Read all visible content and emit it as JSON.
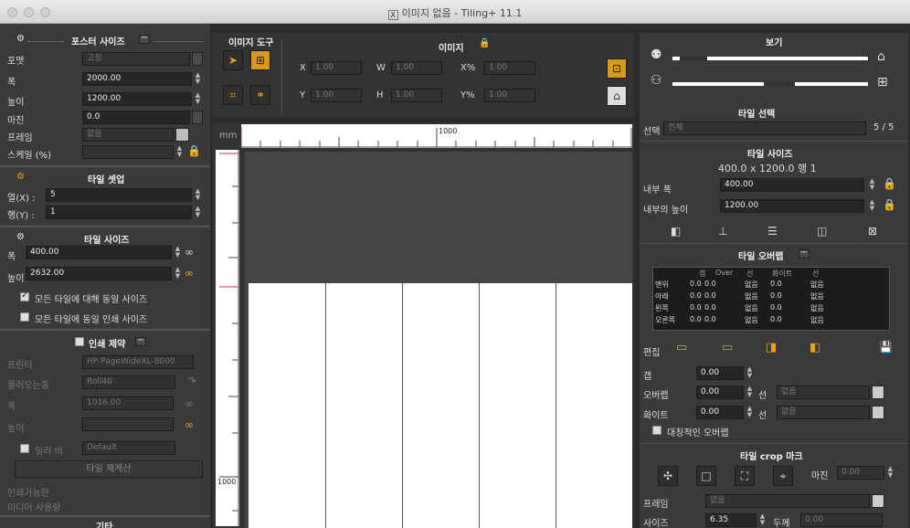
{
  "window": {
    "title": "이미지 없음 - Tiling+ 11.1"
  },
  "left": {
    "poster_size": {
      "header": "포스터 사이즈",
      "format_label": "포맷",
      "format_value": "고정",
      "width_label": "폭",
      "width_value": "2000.00",
      "height_label": "높이",
      "height_value": "1200.00",
      "margin_label": "마진",
      "margin_value": "0.0",
      "frame_label": "프레임",
      "frame_value": "없음",
      "scale_label": "스케일 (%)"
    },
    "tile_settings": {
      "header": "타일 셋업",
      "cols_label": "열(X) :",
      "cols_value": "5",
      "rows_label": "행(Y) :",
      "rows_value": "1"
    },
    "tile_size": {
      "header": "타일 사이즈",
      "width_label": "폭",
      "width_value": "400.00",
      "height_label": "높이",
      "height_value": "2632.00",
      "same_size_all": "모든 타일에 대해 동일 사이즈",
      "same_print_size": "모든 타일에 동일 인쇄 사이즈"
    },
    "print_limit": {
      "header": "인쇄 제약",
      "printer_label": "프린터",
      "printer_value": "HP-PageWideXL-8000",
      "roll_label": "플러오는중",
      "roll_value": "Roll40",
      "width_label": "폭",
      "width_value": "1016.00",
      "height_label": "높이",
      "height_value": "",
      "paper_label": "일러 비",
      "paper_value": "Default",
      "recalc_button": "타일 재계산",
      "printable_label": "인쇄가능한",
      "media_label": "미디어 사용량",
      "misc_header": "기타"
    }
  },
  "toolbar": {
    "image_tools_header": "이미지 도구",
    "image_header": "이미지",
    "x_label": "X",
    "x_value": "1.00",
    "w_label": "W",
    "w_value": "1.00",
    "xpct_label": "X%",
    "xpct_value": "1.00",
    "y_label": "Y",
    "y_value": "1.00",
    "h_label": "H",
    "h_value": "1.00",
    "ypct_label": "Y%",
    "ypct_value": "1.00"
  },
  "canvas": {
    "unit": "mm",
    "ruler_mark_top": "1000",
    "ruler_mark_left": "1000",
    "tile_count": 5
  },
  "right": {
    "view": {
      "header": "보기"
    },
    "tile_select": {
      "header": "타일 선택",
      "select_label": "선택",
      "select_value": "전체",
      "count": "5 / 5"
    },
    "tile_size": {
      "header": "타일 사이즈",
      "summary": "400.0 x 1200.0  행 1",
      "inner_width_label": "내부 폭",
      "inner_width_value": "400.00",
      "inner_height_label": "내부의 높이",
      "inner_height_value": "1200.00"
    },
    "overlap": {
      "header": "타일 오버랩",
      "col_headers": [
        "갭",
        "Over",
        "선",
        "화이트",
        "선"
      ],
      "rows": [
        {
          "name": "맨위",
          "gap": "0.0",
          "over": "0.0",
          "line": "없음",
          "white": "0.0",
          "line2": "없음"
        },
        {
          "name": "아래",
          "gap": "0.0",
          "over": "0.0",
          "line": "없음",
          "white": "0.0",
          "line2": "없음"
        },
        {
          "name": "왼쪽",
          "gap": "0.0",
          "over": "0.0",
          "line": "없음",
          "white": "0.0",
          "line2": "없음"
        },
        {
          "name": "오른쪽",
          "gap": "0.0",
          "over": "0.0",
          "line": "없음",
          "white": "0.0",
          "line2": "없음"
        }
      ],
      "edit_label": "편집",
      "gap_label": "갭",
      "gap_value": "0.00",
      "overlap_label": "오버랩",
      "overlap_value": "0.00",
      "line_label": "선",
      "line_value": "없음",
      "white_label": "화이트",
      "white_value": "0.00",
      "line2_label": "선",
      "line2_value": "없음",
      "symmetric_label": "대칭적인 오버랩"
    },
    "crop": {
      "header": "타일 crop 마크",
      "margin_label": "마진",
      "margin_value": "0.00",
      "frame_label": "프레임",
      "frame_value": "없음",
      "size_label": "사이즈",
      "size_value": "6.35",
      "thickness_label": "두께",
      "thickness_value": "0.00"
    }
  }
}
